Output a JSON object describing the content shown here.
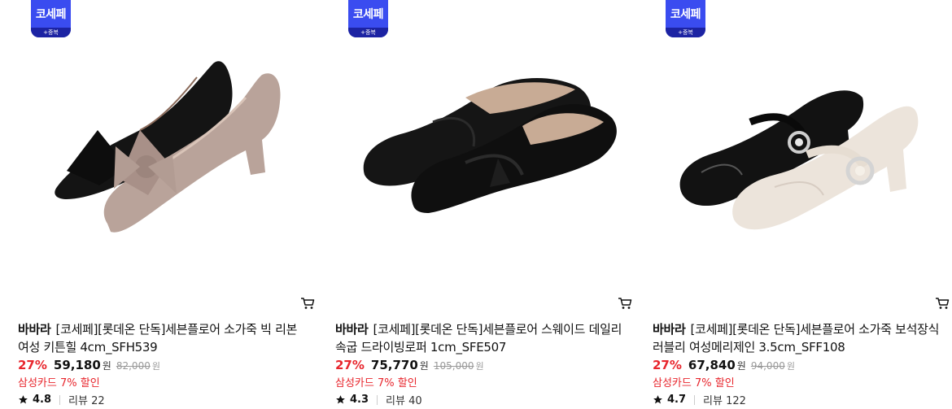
{
  "products": [
    {
      "badge": "코세페",
      "badge_sub": "+중복",
      "brand": "바바라",
      "name": "[코세페][롯데온 단독]세븐플로어 소가죽 빅 리본 여성 키튼힐 4cm_SFH539",
      "discount": "27%",
      "price": "59,180",
      "currency": "원",
      "original_price": "82,000",
      "original_currency": "원",
      "card_promo": "삼성카드 7% 할인",
      "rating": "4.8",
      "reviews": "리뷰 22",
      "image_icon": "bow-pumps-image"
    },
    {
      "badge": "코세페",
      "badge_sub": "+중복",
      "brand": "바바라",
      "name": "[코세페][롯데온 단독]세븐플로어 스웨이드 데일리 속굽 드라이빙로퍼 1cm_SFE507",
      "discount": "27%",
      "price": "75,770",
      "currency": "원",
      "original_price": "105,000",
      "original_currency": "원",
      "card_promo": "삼성카드 7% 할인",
      "rating": "4.3",
      "reviews": "리뷰 40",
      "image_icon": "suede-loafer-image"
    },
    {
      "badge": "코세페",
      "badge_sub": "+중복",
      "brand": "바바라",
      "name": "[코세페][롯데온 단독]세븐플로어 소가죽 보석장식 러블리 여성메리제인 3.5cm_SFF108",
      "discount": "27%",
      "price": "67,840",
      "currency": "원",
      "original_price": "94,000",
      "original_currency": "원",
      "card_promo": "삼성카드 7% 할인",
      "rating": "4.7",
      "reviews": "리뷰 122",
      "image_icon": "mary-jane-image"
    }
  ],
  "colors": {
    "accent_red": "#e8262d",
    "badge_blue": "#3a4cf0",
    "badge_dark": "#1c23a3"
  }
}
